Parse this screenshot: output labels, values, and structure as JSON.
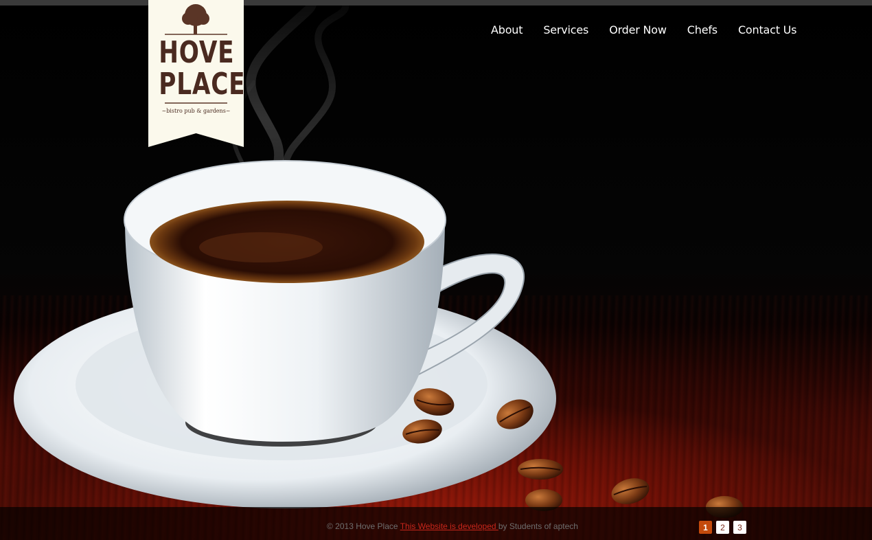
{
  "logo": {
    "line1": "HOVE",
    "line2": "PLACE",
    "tagline": "~bistro pub & gardens~"
  },
  "nav": {
    "items": [
      {
        "label": "About"
      },
      {
        "label": "Services"
      },
      {
        "label": "Order Now"
      },
      {
        "label": "Chefs"
      },
      {
        "label": "Contact Us"
      }
    ]
  },
  "footer": {
    "copyright": "© 2013 Hove Place ",
    "link_text": "This Website is developed ",
    "suffix": "by Students of aptech"
  },
  "pager": {
    "pages": [
      "1",
      "2",
      "3"
    ],
    "active": "1"
  },
  "colors": {
    "accent": "#c44a0c",
    "link": "#c8261b",
    "logo_bg": "#fbf9ec",
    "logo_text": "#4a2a20"
  }
}
